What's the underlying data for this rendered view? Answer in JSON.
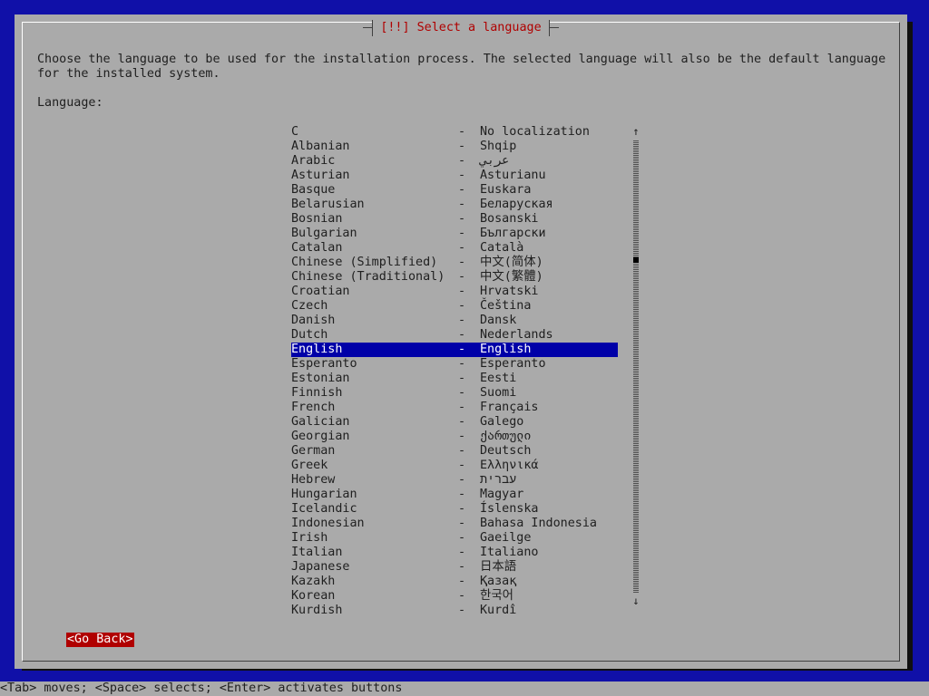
{
  "dialog": {
    "title": "[!!] Select a language",
    "description_line1": "Choose the language to be used for the installation process. The selected language will also be the default language",
    "description_line2": "for the installed system.",
    "language_label": "Language:"
  },
  "languages": [
    {
      "name": "C",
      "native": "No localization"
    },
    {
      "name": "Albanian",
      "native": "Shqip"
    },
    {
      "name": "Arabic",
      "native": "عربي"
    },
    {
      "name": "Asturian",
      "native": "Asturianu"
    },
    {
      "name": "Basque",
      "native": "Euskara"
    },
    {
      "name": "Belarusian",
      "native": "Беларуская"
    },
    {
      "name": "Bosnian",
      "native": "Bosanski"
    },
    {
      "name": "Bulgarian",
      "native": "Български"
    },
    {
      "name": "Catalan",
      "native": "Català"
    },
    {
      "name": "Chinese (Simplified)",
      "native": "中文(简体)"
    },
    {
      "name": "Chinese (Traditional)",
      "native": "中文(繁體)"
    },
    {
      "name": "Croatian",
      "native": "Hrvatski"
    },
    {
      "name": "Czech",
      "native": "Čeština"
    },
    {
      "name": "Danish",
      "native": "Dansk"
    },
    {
      "name": "Dutch",
      "native": "Nederlands"
    },
    {
      "name": "English",
      "native": "English"
    },
    {
      "name": "Esperanto",
      "native": "Esperanto"
    },
    {
      "name": "Estonian",
      "native": "Eesti"
    },
    {
      "name": "Finnish",
      "native": "Suomi"
    },
    {
      "name": "French",
      "native": "Français"
    },
    {
      "name": "Galician",
      "native": "Galego"
    },
    {
      "name": "Georgian",
      "native": "ქართული"
    },
    {
      "name": "German",
      "native": "Deutsch"
    },
    {
      "name": "Greek",
      "native": "Ελληνικά"
    },
    {
      "name": "Hebrew",
      "native": "עברית"
    },
    {
      "name": "Hungarian",
      "native": "Magyar"
    },
    {
      "name": "Icelandic",
      "native": "Íslenska"
    },
    {
      "name": "Indonesian",
      "native": "Bahasa Indonesia"
    },
    {
      "name": "Irish",
      "native": "Gaeilge"
    },
    {
      "name": "Italian",
      "native": "Italiano"
    },
    {
      "name": "Japanese",
      "native": "日本語"
    },
    {
      "name": "Kazakh",
      "native": "Қазақ"
    },
    {
      "name": "Korean",
      "native": "한국어"
    },
    {
      "name": "Kurdish",
      "native": "Kurdî"
    }
  ],
  "selected_language": "English",
  "separator": "-",
  "scrollbar": {
    "up_arrow": "↑",
    "down_arrow": "↓"
  },
  "buttons": {
    "go_back": "<Go Back>"
  },
  "status_bar": "<Tab> moves; <Space> selects; <Enter> activates buttons",
  "colors": {
    "screen_background": "#1010a8",
    "dialog_background": "#aaaaaa",
    "title_text": "#b00000",
    "selection_background": "#0000a8",
    "button_background": "#b00000"
  }
}
